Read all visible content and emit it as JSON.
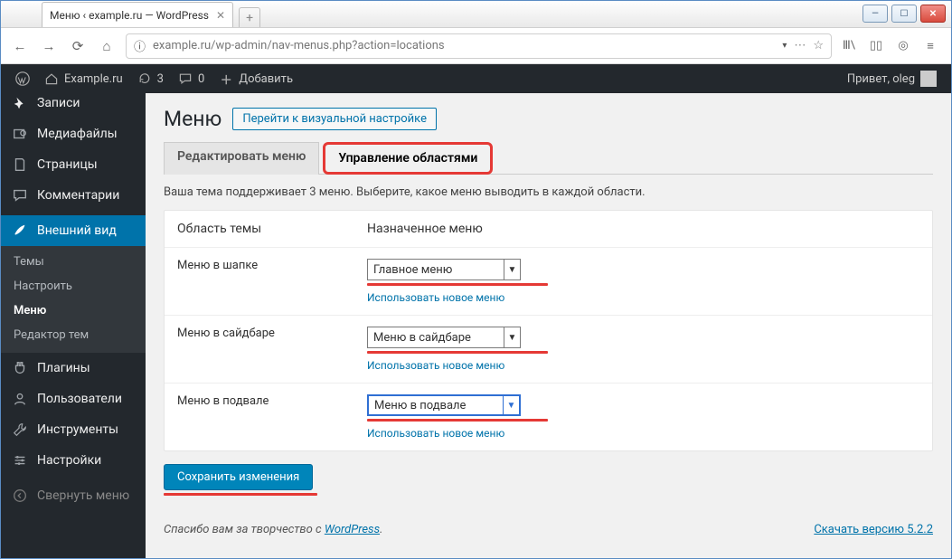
{
  "browser": {
    "tab_title": "Меню ‹ example.ru — WordPress",
    "url": "example.ru/wp-admin/nav-menus.php?action=locations"
  },
  "adminbar": {
    "site": "Example.ru",
    "comments_count": "3",
    "updates_count": "0",
    "new": "Добавить",
    "greeting": "Привет, oleg"
  },
  "sidebar": {
    "items": [
      {
        "id": "posts",
        "label": "Записи"
      },
      {
        "id": "media",
        "label": "Медиафайлы"
      },
      {
        "id": "pages",
        "label": "Страницы"
      },
      {
        "id": "comments",
        "label": "Комментарии"
      },
      {
        "id": "appearance",
        "label": "Внешний вид",
        "current": true
      },
      {
        "id": "plugins",
        "label": "Плагины"
      },
      {
        "id": "users",
        "label": "Пользователи"
      },
      {
        "id": "tools",
        "label": "Инструменты"
      },
      {
        "id": "settings",
        "label": "Настройки"
      },
      {
        "id": "collapse",
        "label": "Свернуть меню"
      }
    ],
    "submenu": [
      {
        "id": "themes",
        "label": "Темы"
      },
      {
        "id": "customize",
        "label": "Настроить"
      },
      {
        "id": "menus",
        "label": "Меню",
        "current": true
      },
      {
        "id": "editor",
        "label": "Редактор тем"
      }
    ]
  },
  "page": {
    "title": "Меню",
    "action": "Перейти к визуальной настройке",
    "tabs": {
      "edit": "Редактировать меню",
      "locations": "Управление областями"
    },
    "description": "Ваша тема поддерживает 3 меню. Выберите, какое меню выводить в каждой области.",
    "col_area": "Область темы",
    "col_assigned": "Назначенное меню",
    "rows": [
      {
        "area": "Меню в шапке",
        "selected": "Главное меню"
      },
      {
        "area": "Меню в сайдбаре",
        "selected": "Меню в сайдбаре"
      },
      {
        "area": "Меню в подвале",
        "selected": "Меню в подвале"
      }
    ],
    "use_new": "Использовать новое меню",
    "save": "Сохранить изменения"
  },
  "footer": {
    "thanks_prefix": "Спасибо вам за творчество с ",
    "thanks_link": "WordPress",
    "thanks_suffix": ".",
    "version_link": "Скачать версию 5.2.2"
  }
}
